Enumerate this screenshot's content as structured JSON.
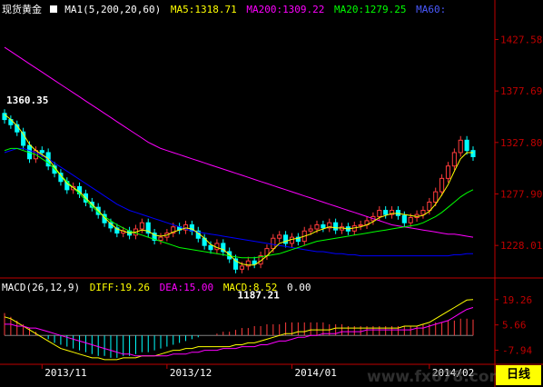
{
  "header": {
    "instrument": "现货黄金",
    "ma_title": "MA1(5,200,20,60)",
    "ma5": "MA5:1318.71",
    "ma200": "MA200:1309.22",
    "ma20": "MA20:1279.25",
    "ma60": "MA60:"
  },
  "macd_header": {
    "title": "MACD(26,12,9)",
    "diff": "DIFF:19.26",
    "dea": "DEA:15.00",
    "macd": "MACD:8.52",
    "extra": "0.00"
  },
  "timeframe_button": "日线",
  "watermark": "www.fx678.com",
  "colors": {
    "up": "#ff3c3c",
    "down": "#00ffff",
    "ma5": "#ffff00",
    "ma200": "#ff00ff",
    "ma20": "#00ff00",
    "ma60": "#0000ff",
    "axis": "#c00000",
    "text": "#ffffff"
  },
  "chart_data": [
    {
      "type": "line",
      "name": "price-candlestick",
      "ylim": [
        1200,
        1450
      ],
      "yticks": [
        {
          "v": 1427.58,
          "label": "1427.58"
        },
        {
          "v": 1377.69,
          "label": "1377.69"
        },
        {
          "v": 1327.8,
          "label": "1327.80"
        },
        {
          "v": 1277.9,
          "label": "1277.90"
        },
        {
          "v": 1228.01,
          "label": "1228.01"
        }
      ],
      "xticks": [
        {
          "i": 6,
          "label": "2013/11"
        },
        {
          "i": 26,
          "label": "2013/12"
        },
        {
          "i": 46,
          "label": "2014/01"
        },
        {
          "i": 68,
          "label": "2014/02"
        }
      ],
      "annotations": [
        {
          "i": 0,
          "v": 1360.35,
          "label": "1360.35",
          "pos": "above"
        },
        {
          "i": 37,
          "v": 1187.21,
          "label": "1187.21",
          "pos": "below"
        }
      ],
      "closes": [
        1350,
        1345,
        1338,
        1325,
        1312,
        1320,
        1318,
        1305,
        1298,
        1290,
        1282,
        1285,
        1278,
        1270,
        1265,
        1258,
        1250,
        1245,
        1240,
        1242,
        1238,
        1244,
        1250,
        1240,
        1233,
        1236,
        1240,
        1246,
        1243,
        1248,
        1242,
        1235,
        1228,
        1224,
        1230,
        1222,
        1215,
        1205,
        1208,
        1213,
        1210,
        1218,
        1225,
        1235,
        1238,
        1230,
        1236,
        1232,
        1242,
        1244,
        1248,
        1245,
        1250,
        1243,
        1246,
        1242,
        1247,
        1248,
        1252,
        1256,
        1262,
        1258,
        1262,
        1257,
        1250,
        1255,
        1258,
        1262,
        1270,
        1280,
        1293,
        1305,
        1318,
        1330,
        1320,
        1314
      ],
      "series": [
        {
          "name": "MA200",
          "values": [
            1420,
            1416,
            1412,
            1408,
            1404,
            1400,
            1396,
            1392,
            1388,
            1384,
            1380,
            1376,
            1372,
            1368,
            1364,
            1360,
            1356,
            1352,
            1348,
            1344,
            1340,
            1336,
            1332,
            1328,
            1325,
            1322,
            1320,
            1318,
            1316,
            1314,
            1312,
            1310,
            1308,
            1306,
            1304,
            1302,
            1300,
            1298,
            1296,
            1294,
            1292,
            1290,
            1288,
            1286,
            1284,
            1282,
            1280,
            1278,
            1276,
            1274,
            1272,
            1270,
            1268,
            1266,
            1264,
            1262,
            1260,
            1258,
            1256,
            1254,
            1252,
            1250,
            1248,
            1247,
            1246,
            1245,
            1244,
            1243,
            1242,
            1241,
            1240,
            1239,
            1239,
            1238,
            1237,
            1236
          ]
        },
        {
          "name": "MA60",
          "values": [
            1318,
            1320,
            1322,
            1322,
            1320,
            1318,
            1315,
            1312,
            1308,
            1304,
            1300,
            1296,
            1292,
            1288,
            1284,
            1280,
            1276,
            1272,
            1268,
            1265,
            1262,
            1260,
            1258,
            1256,
            1254,
            1252,
            1250,
            1248,
            1246,
            1244,
            1242,
            1241,
            1240,
            1239,
            1238,
            1237,
            1236,
            1235,
            1234,
            1233,
            1232,
            1231,
            1230,
            1229,
            1228,
            1227,
            1226,
            1225,
            1224,
            1223,
            1222,
            1222,
            1221,
            1220,
            1220,
            1219,
            1219,
            1218,
            1218,
            1218,
            1218,
            1218,
            1218,
            1218,
            1218,
            1218,
            1218,
            1218,
            1218,
            1218,
            1218,
            1218,
            1219,
            1219,
            1220,
            1220
          ]
        },
        {
          "name": "MA20",
          "values": [
            1320,
            1322,
            1322,
            1320,
            1318,
            1316,
            1312,
            1308,
            1302,
            1296,
            1290,
            1284,
            1278,
            1272,
            1266,
            1260,
            1256,
            1252,
            1248,
            1245,
            1242,
            1240,
            1238,
            1236,
            1234,
            1232,
            1230,
            1228,
            1226,
            1225,
            1224,
            1223,
            1222,
            1221,
            1220,
            1219,
            1218,
            1217,
            1216,
            1216,
            1216,
            1217,
            1218,
            1219,
            1220,
            1222,
            1224,
            1226,
            1228,
            1230,
            1232,
            1233,
            1234,
            1235,
            1236,
            1237,
            1238,
            1239,
            1240,
            1241,
            1242,
            1243,
            1244,
            1245,
            1246,
            1247,
            1248,
            1250,
            1253,
            1256,
            1260,
            1265,
            1270,
            1275,
            1279,
            1282
          ]
        },
        {
          "name": "MA5",
          "values": [
            1355,
            1350,
            1344,
            1336,
            1326,
            1320,
            1316,
            1312,
            1304,
            1296,
            1288,
            1284,
            1280,
            1274,
            1268,
            1262,
            1255,
            1249,
            1244,
            1242,
            1240,
            1241,
            1243,
            1242,
            1238,
            1237,
            1238,
            1241,
            1243,
            1245,
            1244,
            1240,
            1235,
            1229,
            1226,
            1224,
            1219,
            1213,
            1210,
            1209,
            1209,
            1213,
            1218,
            1224,
            1230,
            1232,
            1234,
            1235,
            1237,
            1239,
            1242,
            1244,
            1246,
            1245,
            1245,
            1244,
            1245,
            1246,
            1248,
            1251,
            1255,
            1257,
            1259,
            1259,
            1258,
            1257,
            1256,
            1257,
            1261,
            1268,
            1277,
            1287,
            1300,
            1312,
            1318,
            1318
          ]
        }
      ]
    },
    {
      "type": "bar",
      "name": "macd-histogram",
      "ylim": [
        -15,
        25
      ],
      "yticks": [
        {
          "v": 19.26,
          "label": "19.26"
        },
        {
          "v": 5.66,
          "label": "5.66"
        },
        {
          "v": -7.94,
          "label": "-7.94"
        }
      ],
      "hist": [
        12,
        10,
        8,
        6,
        4,
        2,
        0,
        -2,
        -4,
        -5,
        -6,
        -7,
        -8,
        -9,
        -10,
        -11,
        -11,
        -12,
        -12,
        -11,
        -11,
        -10,
        -9,
        -9,
        -8,
        -7,
        -6,
        -5,
        -4,
        -3,
        -2,
        -1,
        0,
        0,
        1,
        2,
        2,
        3,
        4,
        4,
        5,
        5,
        6,
        6,
        6,
        7,
        7,
        7,
        7,
        7,
        7,
        7,
        6,
        6,
        6,
        5,
        5,
        5,
        5,
        5,
        5,
        5,
        5,
        5,
        5,
        5,
        5,
        6,
        6,
        7,
        7,
        8,
        8,
        9,
        9,
        8.52
      ],
      "series": [
        {
          "name": "DIFF",
          "values": [
            10,
            9,
            7,
            5,
            3,
            1,
            -1,
            -3,
            -5,
            -7,
            -8,
            -9,
            -10,
            -11,
            -12,
            -12,
            -13,
            -13,
            -13,
            -12,
            -12,
            -12,
            -11,
            -11,
            -11,
            -10,
            -9,
            -8,
            -8,
            -7,
            -7,
            -6,
            -6,
            -6,
            -6,
            -6,
            -6,
            -5,
            -5,
            -4,
            -4,
            -3,
            -2,
            -1,
            0,
            1,
            1,
            2,
            2,
            3,
            3,
            3,
            3,
            4,
            4,
            4,
            4,
            4,
            4,
            4,
            4,
            4,
            4,
            4,
            5,
            5,
            5,
            6,
            7,
            9,
            11,
            13,
            15,
            17,
            19,
            19.26
          ]
        },
        {
          "name": "DEA",
          "values": [
            6,
            6,
            5,
            5,
            4,
            4,
            3,
            2,
            1,
            0,
            -1,
            -2,
            -3,
            -4,
            -5,
            -6,
            -7,
            -8,
            -9,
            -10,
            -10,
            -11,
            -11,
            -11,
            -11,
            -11,
            -11,
            -10,
            -10,
            -10,
            -9,
            -9,
            -8,
            -8,
            -8,
            -7,
            -7,
            -7,
            -6,
            -6,
            -6,
            -5,
            -5,
            -4,
            -3,
            -3,
            -2,
            -1,
            -1,
            0,
            0,
            1,
            1,
            1,
            2,
            2,
            2,
            2,
            3,
            3,
            3,
            3,
            3,
            3,
            3,
            3,
            4,
            4,
            5,
            6,
            7,
            8,
            10,
            12,
            14,
            15
          ]
        }
      ]
    }
  ]
}
